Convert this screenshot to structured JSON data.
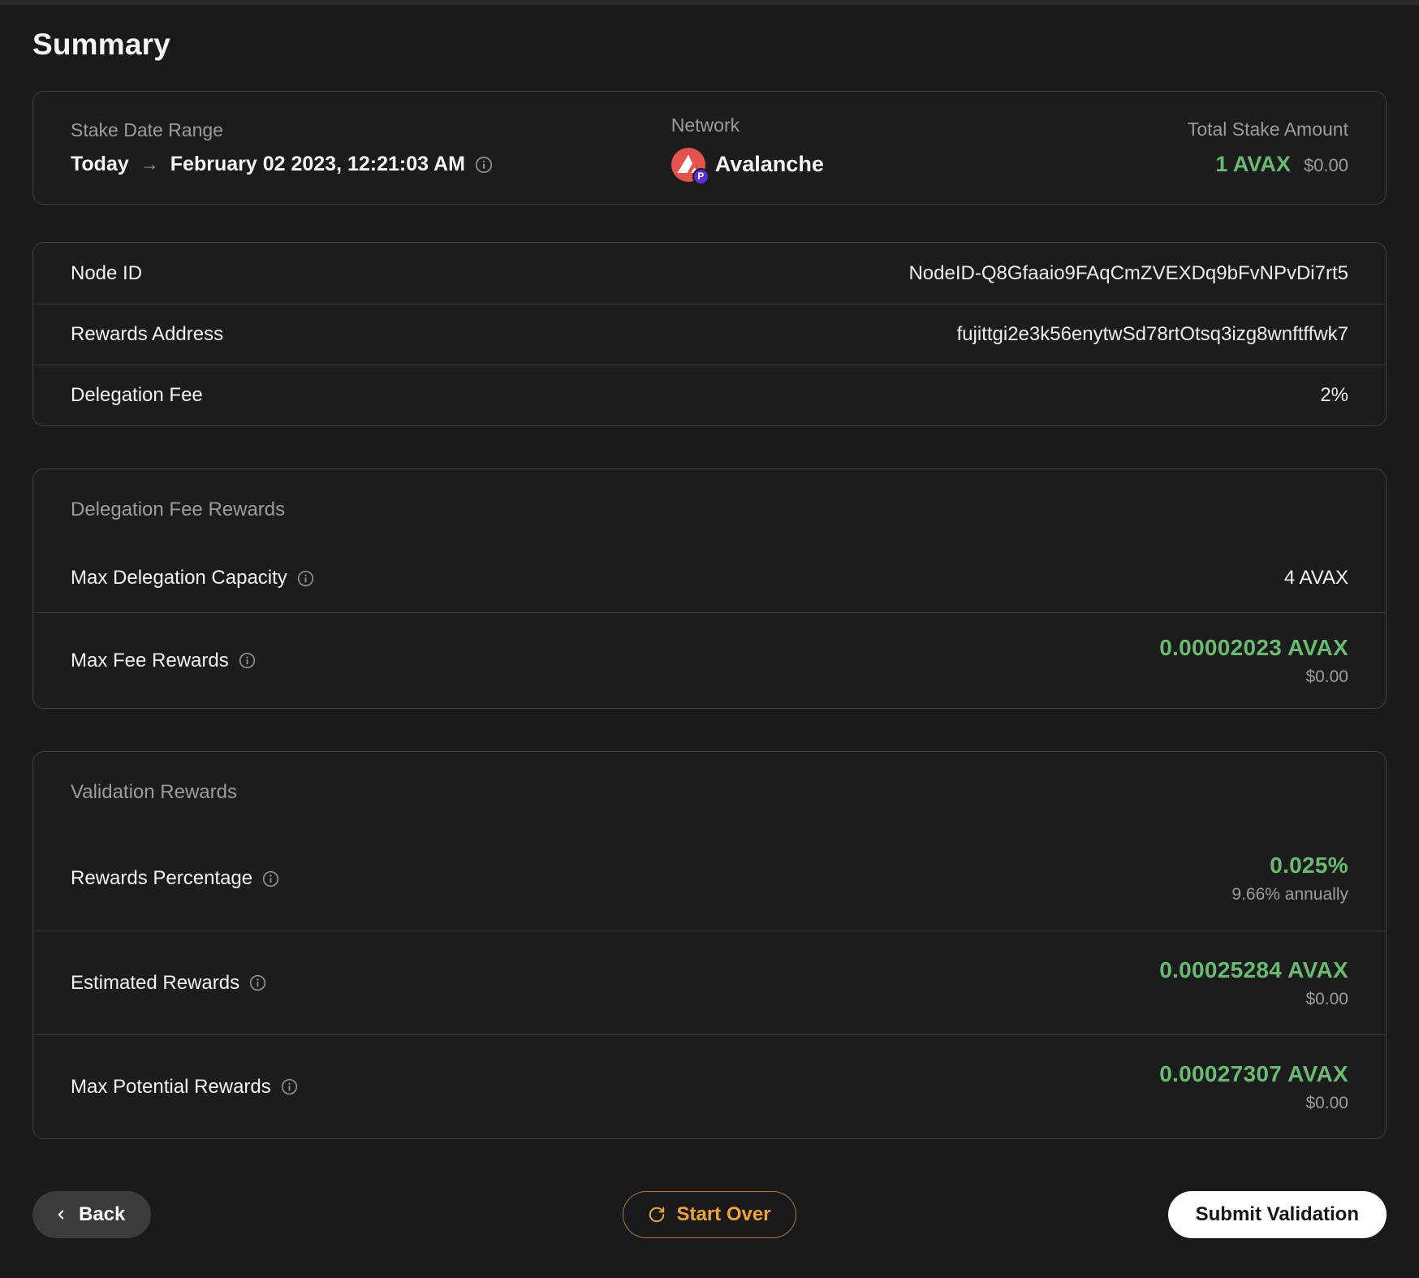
{
  "header": {
    "title": "Summary"
  },
  "overview": {
    "date_range": {
      "label": "Stake Date Range",
      "from": "Today",
      "arrow": "→",
      "to": "February 02 2023, 12:21:03 AM"
    },
    "network": {
      "label": "Network",
      "name": "Avalanche",
      "chain_badge": "P"
    },
    "total_stake": {
      "label": "Total Stake Amount",
      "amount": "1 AVAX",
      "usd": "$0.00"
    }
  },
  "node_details": {
    "rows": [
      {
        "label": "Node ID",
        "value": "NodeID-Q8Gfaaio9FAqCmZVEXDq9bFvNPvDi7rt5"
      },
      {
        "label": "Rewards Address",
        "value": "fujittgi2e3k56enytwSd78rtOtsq3izg8wnftffwk7"
      },
      {
        "label": "Delegation Fee",
        "value": "2%"
      }
    ]
  },
  "delegation_fee_rewards": {
    "header": "Delegation Fee Rewards",
    "max_delegation_capacity": {
      "label": "Max Delegation Capacity",
      "value": "4 AVAX"
    },
    "max_fee_rewards": {
      "label": "Max Fee Rewards",
      "value": "0.00002023 AVAX",
      "usd": "$0.00"
    }
  },
  "validation_rewards": {
    "header": "Validation Rewards",
    "rewards_percentage": {
      "label": "Rewards Percentage",
      "value": "0.025%",
      "sub": "9.66% annually"
    },
    "estimated_rewards": {
      "label": "Estimated Rewards",
      "value": "0.00025284 AVAX",
      "usd": "$0.00"
    },
    "max_potential_rewards": {
      "label": "Max Potential Rewards",
      "value": "0.00027307 AVAX",
      "usd": "$0.00"
    }
  },
  "footer": {
    "back_label": "Back",
    "start_over_label": "Start Over",
    "submit_label": "Submit Validation"
  },
  "colors": {
    "accent_green": "#6abb70",
    "accent_orange": "#f0a23c",
    "avalanche_red": "#e2544d",
    "p_chain_purple": "#5b2ed8"
  }
}
